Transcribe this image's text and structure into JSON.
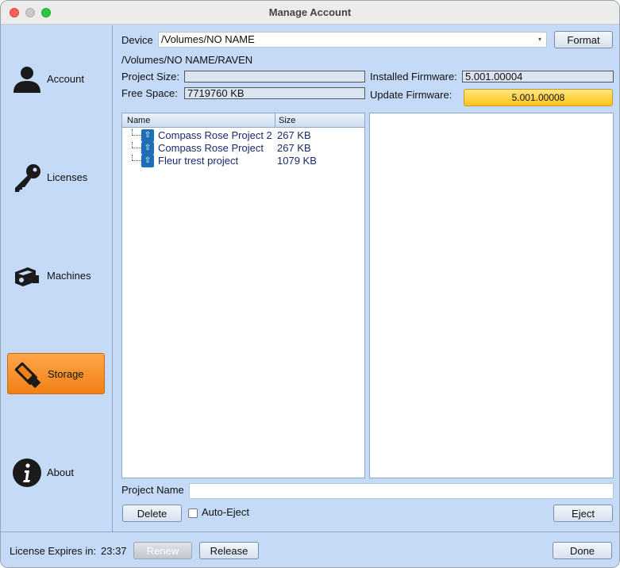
{
  "window": {
    "title": "Manage Account"
  },
  "sidebar": {
    "items": [
      {
        "label": "Account",
        "icon": "person-icon",
        "active": false
      },
      {
        "label": "Licenses",
        "icon": "key-icon",
        "active": false
      },
      {
        "label": "Machines",
        "icon": "machines-icon",
        "active": false
      },
      {
        "label": "Storage",
        "icon": "usb-drive-icon",
        "active": true
      },
      {
        "label": "About",
        "icon": "info-icon",
        "active": false
      }
    ]
  },
  "device": {
    "label": "Device",
    "selected": "/Volumes/NO NAME",
    "format_label": "Format",
    "path": "/Volumes/NO NAME/RAVEN"
  },
  "stats": {
    "project_size_label": "Project Size:",
    "project_size_value": "",
    "free_space_label": "Free Space:",
    "free_space_value": "7719760 KB",
    "installed_fw_label": "Installed Firmware:",
    "installed_fw_value": "5.001.00004",
    "update_fw_label": "Update Firmware:",
    "update_fw_button": "5.001.00008"
  },
  "files": {
    "col_name": "Name",
    "col_size": "Size",
    "rows": [
      {
        "name": "Compass Rose Project 2",
        "size": "267 KB"
      },
      {
        "name": "Compass Rose Project",
        "size": "267 KB"
      },
      {
        "name": "Fleur trest project",
        "size": "1079 KB"
      }
    ]
  },
  "project": {
    "name_label": "Project Name",
    "name_value": "",
    "delete_label": "Delete",
    "auto_eject_label": "Auto-Eject",
    "eject_label": "Eject"
  },
  "footer": {
    "license_label": "License Expires in:",
    "license_time": "23:37",
    "renew_label": "Renew",
    "release_label": "Release",
    "done_label": "Done"
  },
  "colors": {
    "accent_orange": "#f08014",
    "firmware_gold": "#ffc41a",
    "background": "#c5daf6"
  }
}
